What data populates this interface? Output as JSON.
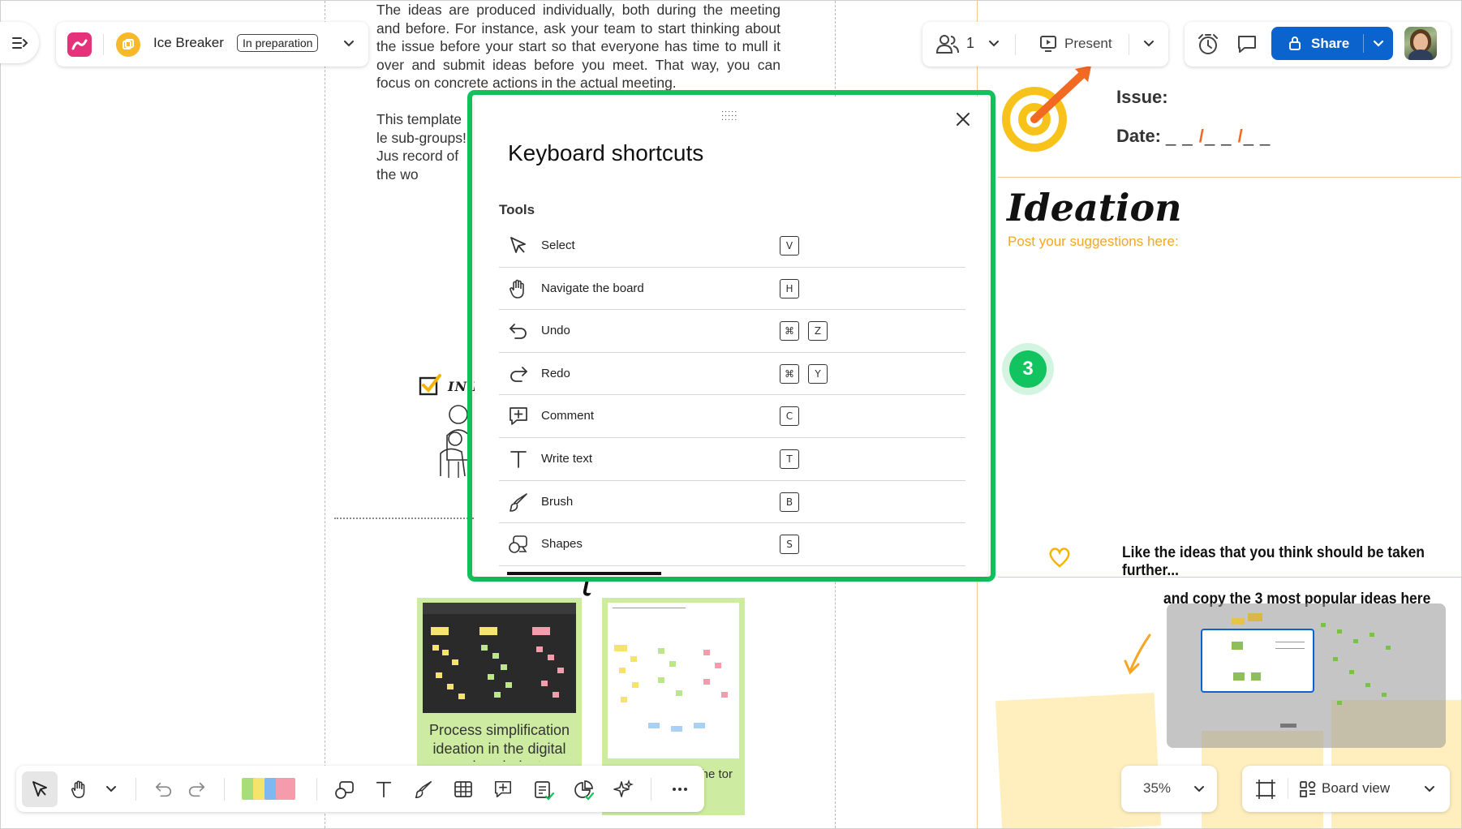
{
  "board": {
    "intro_paragraphs": [
      "The ideas are produced individually, both during the meeting and before. For instance, ask your team to start thinking about the issue before your start so that everyone has time to mull it over and submit ideas before you meet. That way, you can focus on concrete actions in the actual meeting.",
      "This template le sub-groups!  Jus record of the wo"
    ],
    "section_heading_partial": "IN F",
    "cards": [
      {
        "caption": "Process simplification ideation in the digital services industry"
      },
      {
        "caption": "client the tor"
      }
    ],
    "issue_label": "Issue:",
    "date_label": "Date:",
    "date_blank_1": "_ _",
    "date_blank_2": "_ _",
    "date_blank_3": "_ _",
    "date_slash": "/",
    "ideation_title": "Ideation",
    "ideation_subtitle": "Post your suggestions here:",
    "vote_badge": "3",
    "like_text": "Like the ideas that you think should be taken further...",
    "copy_text": "and copy the 3 most popular ideas here"
  },
  "header": {
    "board_name": "Ice Breaker",
    "status": "In preparation",
    "collaborators_count": "1",
    "present_label": "Present",
    "share_label": "Share"
  },
  "modal": {
    "title": "Keyboard shortcuts",
    "section": "Tools",
    "shortcuts": [
      {
        "name": "Select",
        "keys": [
          "V"
        ]
      },
      {
        "name": "Navigate the board",
        "keys": [
          "H"
        ]
      },
      {
        "name": "Undo",
        "keys": [
          "⌘",
          "Z"
        ]
      },
      {
        "name": "Redo",
        "keys": [
          "⌘",
          "Y"
        ]
      },
      {
        "name": "Comment",
        "keys": [
          "C"
        ]
      },
      {
        "name": "Write text",
        "keys": [
          "T"
        ]
      },
      {
        "name": "Brush",
        "keys": [
          "B"
        ]
      },
      {
        "name": "Shapes",
        "keys": [
          "S"
        ]
      }
    ]
  },
  "footer": {
    "zoom": "35%",
    "view_label": "Board view"
  },
  "colors": {
    "accent_blue": "#0b63ce",
    "focus_green": "#13c25c",
    "brand_pink": "#e6327a",
    "ideation_orange": "#f5a623",
    "card_green": "#cdeca1"
  },
  "icons": [
    "sidebar-toggle-icon",
    "app-logo-icon",
    "space-icon",
    "chevron-down-icon",
    "users-icon",
    "present-icon",
    "timer-icon",
    "comment-icon",
    "lock-icon",
    "drag-handle-icon",
    "close-icon",
    "select-icon",
    "hand-icon",
    "undo-icon",
    "redo-icon",
    "comment-add-icon",
    "text-icon",
    "brush-icon",
    "shapes-icon",
    "table-icon",
    "sticky-notes-icon",
    "more-icon",
    "sparkle-icon",
    "frame-icon",
    "board-view-icon",
    "target-icon",
    "heart-icon",
    "checkbox-icon"
  ]
}
